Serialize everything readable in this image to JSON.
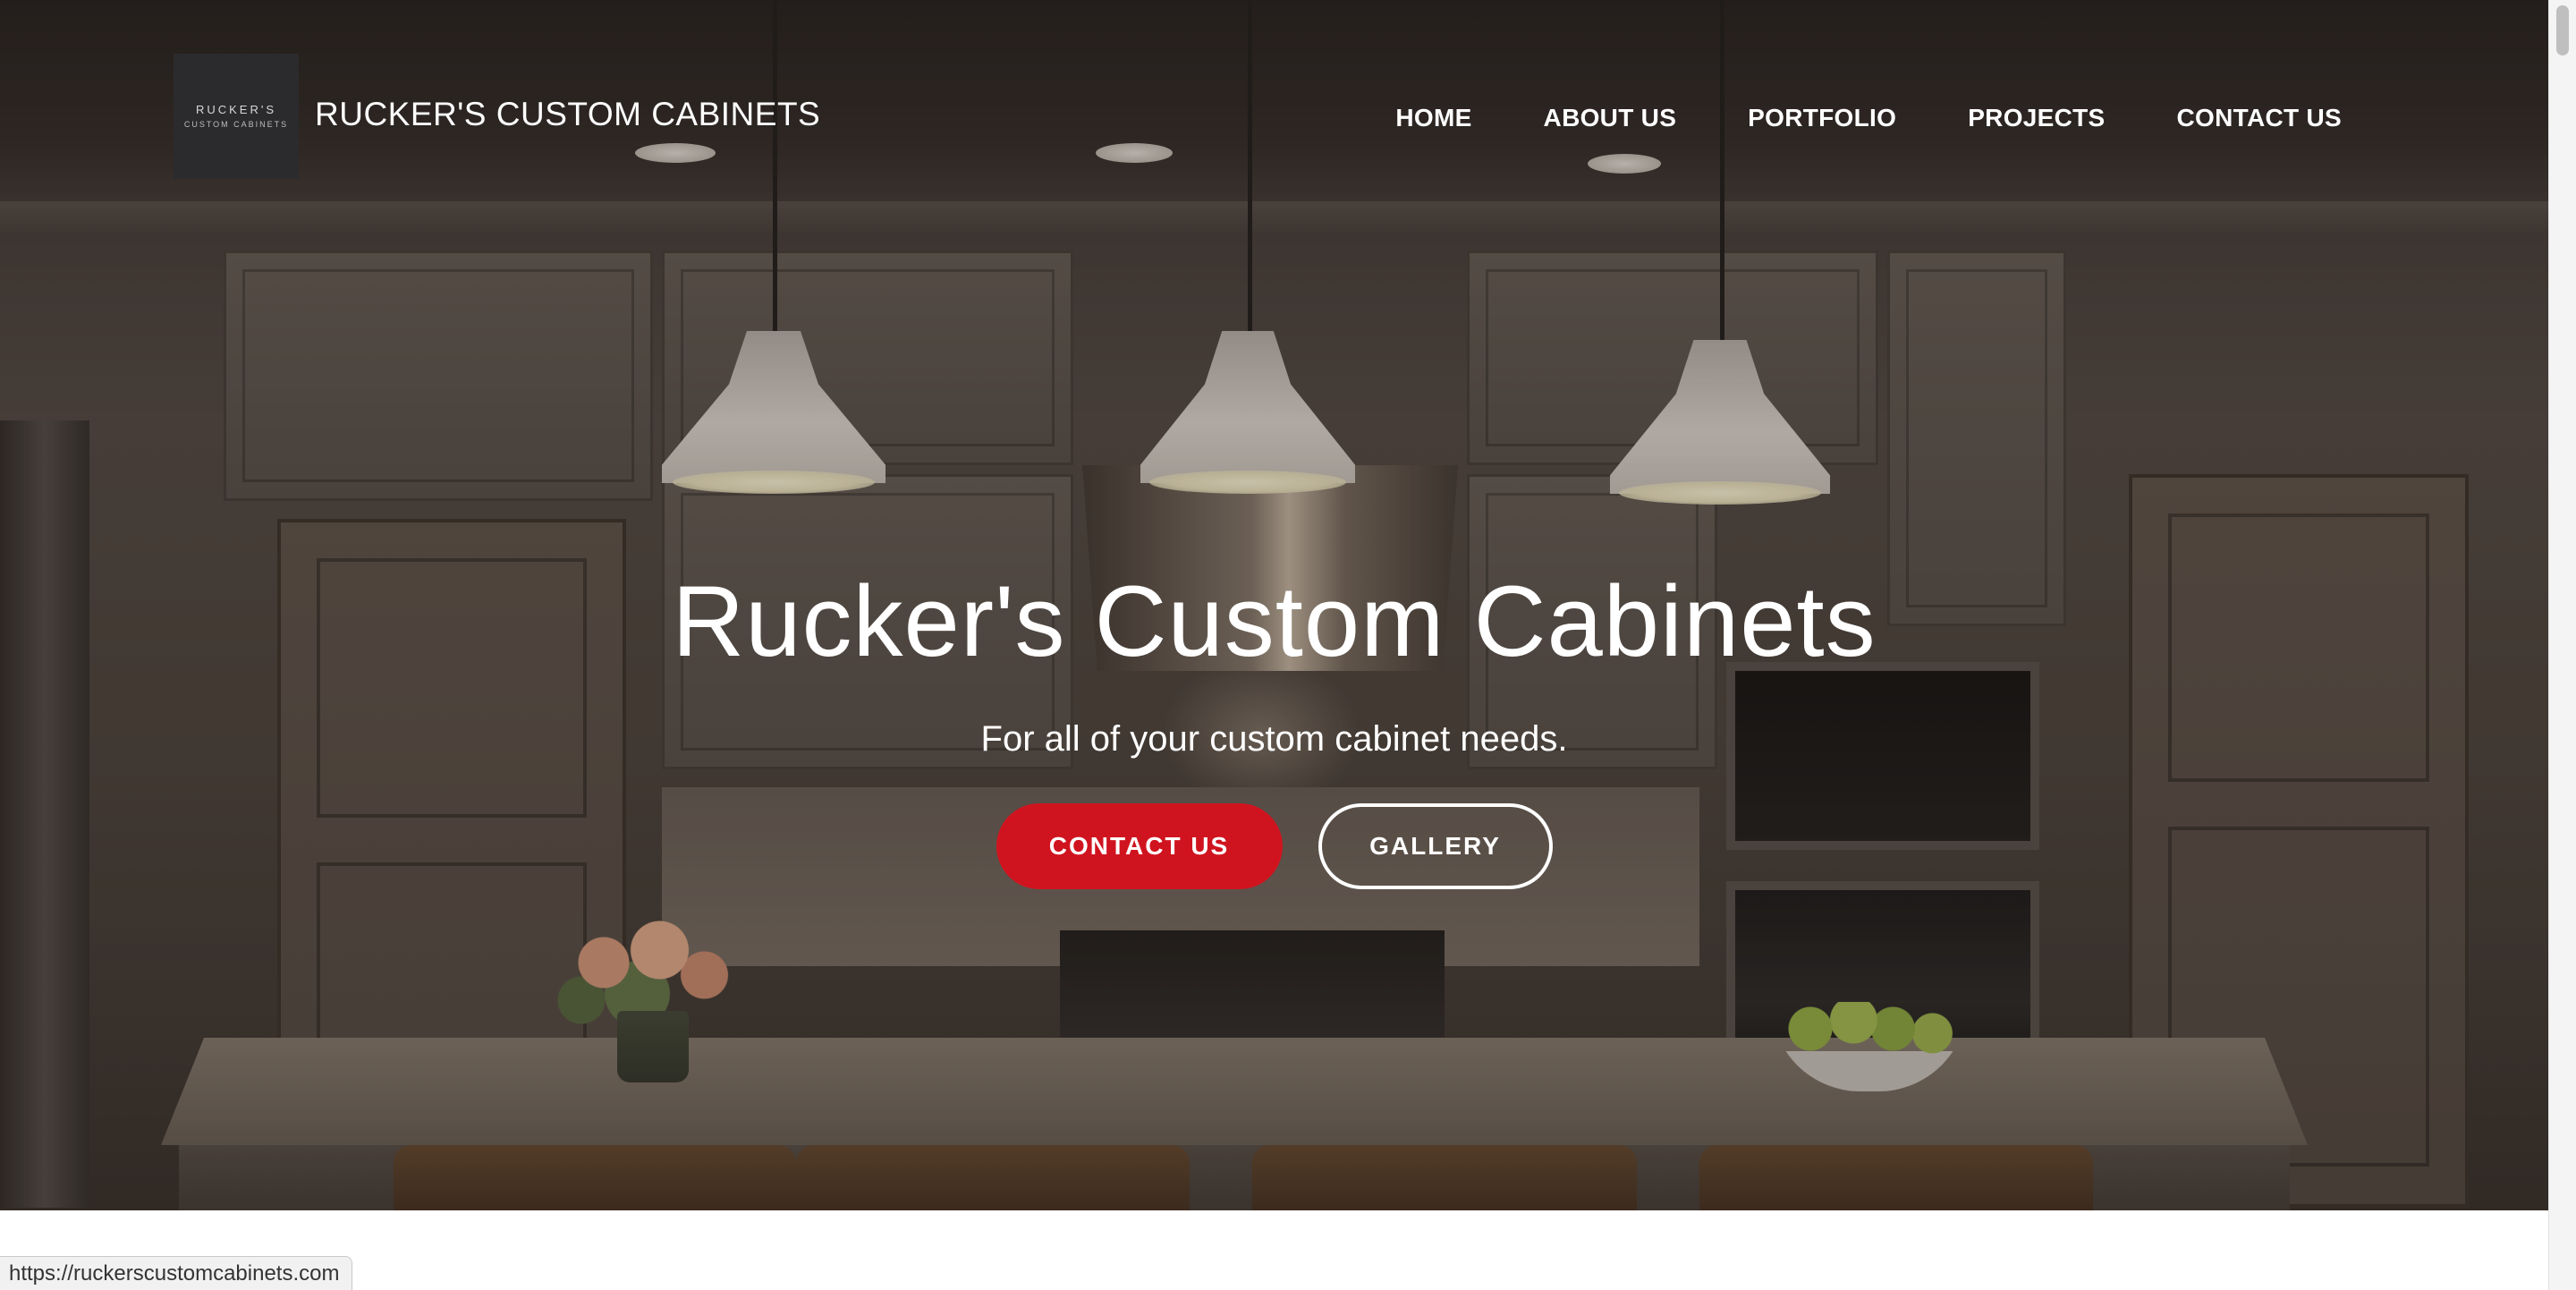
{
  "header": {
    "logo": {
      "line1": "RUCKER'S",
      "line2": "CUSTOM CABINETS"
    },
    "site_title": "RUCKER'S CUSTOM CABINETS",
    "nav": [
      {
        "label": "HOME"
      },
      {
        "label": "ABOUT US"
      },
      {
        "label": "PORTFOLIO"
      },
      {
        "label": "PROJECTS"
      },
      {
        "label": "CONTACT US"
      }
    ]
  },
  "hero": {
    "title": "Rucker's Custom Cabinets",
    "subtitle": "For all of your custom cabinet needs.",
    "primary_button": "CONTACT US",
    "secondary_button": "GALLERY",
    "background_description_icon": "kitchen-photo"
  },
  "status_bar": {
    "url": "https://ruckerscustomcabinets.com"
  },
  "colors": {
    "accent": "#d0141f",
    "text_on_hero": "#ffffff",
    "logo_background": "#2b2b2d"
  }
}
